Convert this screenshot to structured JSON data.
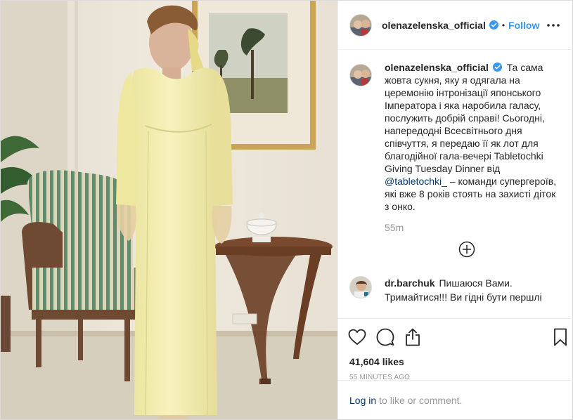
{
  "post": {
    "author": "olenazelenska_official",
    "verified": true,
    "separator": "•",
    "follow_label": "Follow",
    "more_icon": "more-horizontal-icon"
  },
  "photo": {
    "description_icon": "post-photo"
  },
  "caption": {
    "author": "olenazelenska_official",
    "text_part1": "Та сама жовта сукня, яку я одягала на церемонію інтронізації японського Імператора і яка наробила галасу, послужить добрій справі! Сьогодні, напередодні Всесвітнього дня співчуття, я передаю її як лот для благодійної гала-вечері Tabletochki Giving Tuesday Dinner від",
    "mention": "@tabletochki_",
    "text_part2": "– команди супергероїв, які вже 8 років стоять на захисті діток з онко.",
    "time": "55m"
  },
  "load_more_icon": "plus-circle-icon",
  "comment": {
    "author": "dr.barchuk",
    "text": "Пишаюся Вами. Тримайтися!!! Ви гідні бути першлі"
  },
  "actions": {
    "like_icon": "heart-icon",
    "comment_icon": "comment-icon",
    "share_icon": "share-icon",
    "save_icon": "bookmark-icon"
  },
  "likes": "41,604 likes",
  "timestamp": "55 MINUTES AGO",
  "login": {
    "link": "Log in",
    "rest": "to like or comment."
  },
  "colors": {
    "link_blue": "#3897f0",
    "mention_blue": "#003569",
    "text": "#262626",
    "muted": "#999999",
    "border": "#efefef"
  }
}
